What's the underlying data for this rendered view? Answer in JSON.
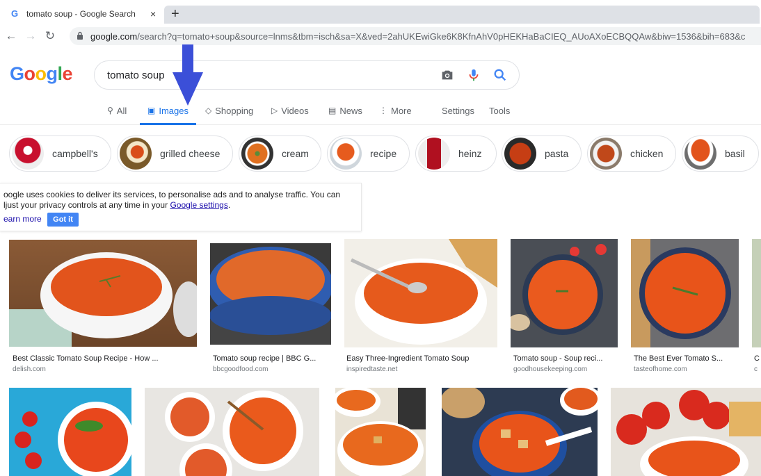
{
  "browser": {
    "tab_title": "tomato soup - Google Search",
    "tab_favicon": "G",
    "tab_close": "×",
    "new_tab": "+",
    "url_host": "google.com",
    "url_path": "/search?q=tomato+soup&source=lnms&tbm=isch&sa=X&ved=2ahUKEwiGke6K8KfnAhV0pHEKHaBaCIEQ_AUoAXoECBQQAw&biw=1536&bih=683&c"
  },
  "logo": [
    "G",
    "o",
    "o",
    "g",
    "l",
    "e"
  ],
  "logo_colors": [
    "#4285f4",
    "#ea4335",
    "#fbbc05",
    "#4285f4",
    "#34a853",
    "#ea4335"
  ],
  "search": {
    "query": "tomato soup"
  },
  "nav": {
    "all": "All",
    "images": "Images",
    "shopping": "Shopping",
    "videos": "Videos",
    "news": "News",
    "more": "More",
    "settings": "Settings",
    "tools": "Tools"
  },
  "chips": [
    "campbell's",
    "grilled cheese",
    "cream",
    "recipe",
    "heinz",
    "pasta",
    "chicken",
    "basil"
  ],
  "cookie": {
    "line1": "oogle uses cookies to deliver its services, to personalise ads and to analyse traffic. You can",
    "line2_prefix": "ljust your privacy controls at any time in your ",
    "line2_link": "Google settings",
    "line2_suffix": ".",
    "learn_more": "earn more",
    "got_it": "Got it"
  },
  "results": [
    {
      "caption": "Best Classic Tomato Soup Recipe - How ...",
      "source": "delish.com"
    },
    {
      "caption": "Tomato soup recipe | BBC G...",
      "source": "bbcgoodfood.com"
    },
    {
      "caption": "Easy Three-Ingredient Tomato Soup",
      "source": "inspiredtaste.net"
    },
    {
      "caption": "Tomato soup - Soup reci...",
      "source": "goodhousekeeping.com"
    },
    {
      "caption": "The Best Ever Tomato S...",
      "source": "tasteofhome.com"
    },
    {
      "caption": "C",
      "source": "c"
    }
  ],
  "colors": {
    "accent": "#1a73e8",
    "soup": "#e2541c",
    "bowl": "#ffffff"
  }
}
